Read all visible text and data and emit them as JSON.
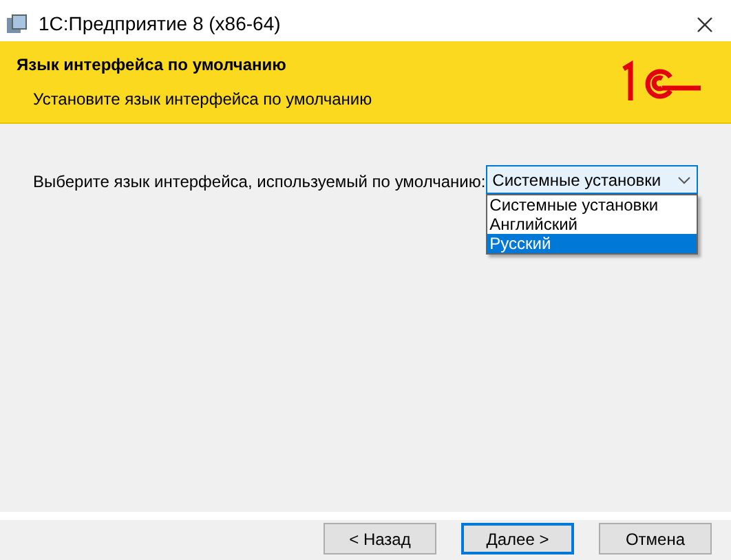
{
  "window": {
    "title": "1С:Предприятие 8 (x86-64)"
  },
  "header": {
    "title": "Язык интерфейса по умолчанию",
    "subtitle": "Установите язык интерфейса по умолчанию"
  },
  "language": {
    "label": "Выберите язык интерфейса, используемый по умолчанию:",
    "value": "Системные установки",
    "expanded": true,
    "options": [
      {
        "label": "Системные установки",
        "highlighted": false
      },
      {
        "label": "Английский",
        "highlighted": false
      },
      {
        "label": "Русский",
        "highlighted": true
      }
    ]
  },
  "buttons": [
    {
      "label": "< Назад",
      "focused": false
    },
    {
      "label": "Далее >",
      "focused": true
    },
    {
      "label": "Отмена",
      "focused": false
    }
  ]
}
